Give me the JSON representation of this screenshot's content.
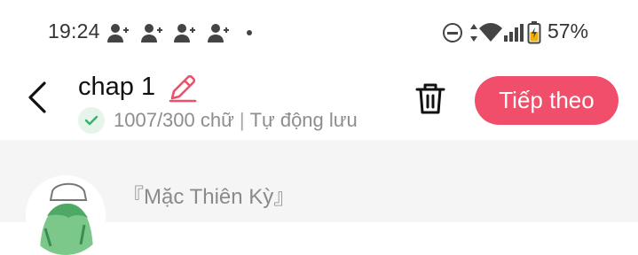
{
  "status_bar": {
    "time": "19:24",
    "notification_icons": [
      "person-add-icon",
      "person-add-icon",
      "person-add-icon",
      "person-add-icon"
    ],
    "battery_percent": "57%"
  },
  "header": {
    "title": "chap 1",
    "word_count": "1007/300 chữ",
    "separator": "|",
    "autosave": "Tự động lưu",
    "next_button": "Tiếp theo"
  },
  "content": {
    "character_name": "『Mặc Thiên Kỳ』"
  },
  "colors": {
    "accent": "#f04e6a",
    "success": "#34b36a",
    "content_bg": "#f5f5f5"
  }
}
